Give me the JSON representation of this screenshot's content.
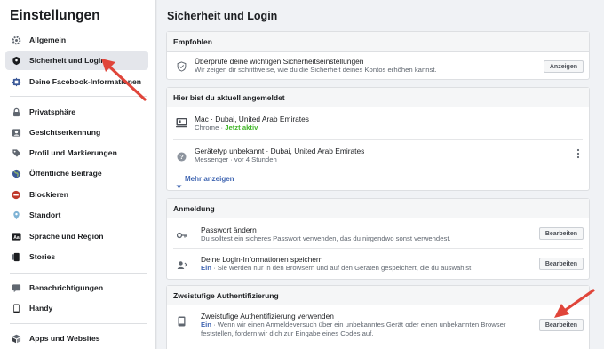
{
  "sidebar": {
    "title": "Einstellungen",
    "items": [
      {
        "label": "Allgemein",
        "icon": "gear-icon"
      },
      {
        "label": "Sicherheit und Login",
        "icon": "shield-icon"
      },
      {
        "label": "Deine Facebook-Informationen",
        "icon": "facebook-info-icon"
      },
      {
        "label": "Privatsphäre",
        "icon": "lock-icon"
      },
      {
        "label": "Gesichtserkennung",
        "icon": "face-recognition-icon"
      },
      {
        "label": "Profil und Markierungen",
        "icon": "tag-icon"
      },
      {
        "label": "Öffentliche Beiträge",
        "icon": "globe-icon"
      },
      {
        "label": "Blockieren",
        "icon": "block-icon"
      },
      {
        "label": "Standort",
        "icon": "location-icon"
      },
      {
        "label": "Sprache und Region",
        "icon": "language-icon"
      },
      {
        "label": "Stories",
        "icon": "stories-icon"
      },
      {
        "label": "Benachrichtigungen",
        "icon": "bell-icon"
      },
      {
        "label": "Handy",
        "icon": "phone-icon"
      },
      {
        "label": "Apps und Websites",
        "icon": "apps-icon"
      }
    ]
  },
  "main": {
    "title": "Sicherheit und Login",
    "recommended": {
      "header": "Empfohlen",
      "title": "Überprüfe deine wichtigen Sicherheitseinstellungen",
      "subtitle": "Wir zeigen dir schrittweise, wie du die Sicherheit deines Kontos erhöhen kannst.",
      "button": "Anzeigen"
    },
    "sessions": {
      "header": "Hier bist du aktuell angemeldet",
      "items": [
        {
          "title": "Mac · Dubai, United Arab Emirates",
          "app": "Chrome",
          "sep": " · ",
          "status": "Jetzt aktiv"
        },
        {
          "title": "Gerätetyp unbekannt · Dubai, United Arab Emirates",
          "app": "Messenger",
          "sep": " · ",
          "status": "vor 4 Stunden"
        }
      ],
      "more": "Mehr anzeigen"
    },
    "login": {
      "header": "Anmeldung",
      "items": [
        {
          "title": "Passwort ändern",
          "subtitle": "Du solltest ein sicheres Passwort verwenden, das du nirgendwo sonst verwendest.",
          "button": "Bearbeiten"
        },
        {
          "title": "Deine Login-Informationen speichern",
          "state": "Ein",
          "subtitle": " · Sie werden nur in den Browsern und auf den Geräten gespeichert, die du auswählst",
          "button": "Bearbeiten"
        }
      ]
    },
    "twofa": {
      "header": "Zweistufige Authentifizierung",
      "title": "Zweistufige Authentifizierung verwenden",
      "state": "Ein",
      "subtitle1": " · Wenn wir einen Anmeldeversuch über ein unbekanntes Gerät oder einen unbekannten Browser",
      "subtitle2": "feststellen, fordern wir dich zur Eingabe eines Codes auf.",
      "button": "Bearbeiten"
    }
  },
  "colors": {
    "accent": "#4267b2",
    "active": "#42b72a",
    "annotation": "#e0453a"
  }
}
